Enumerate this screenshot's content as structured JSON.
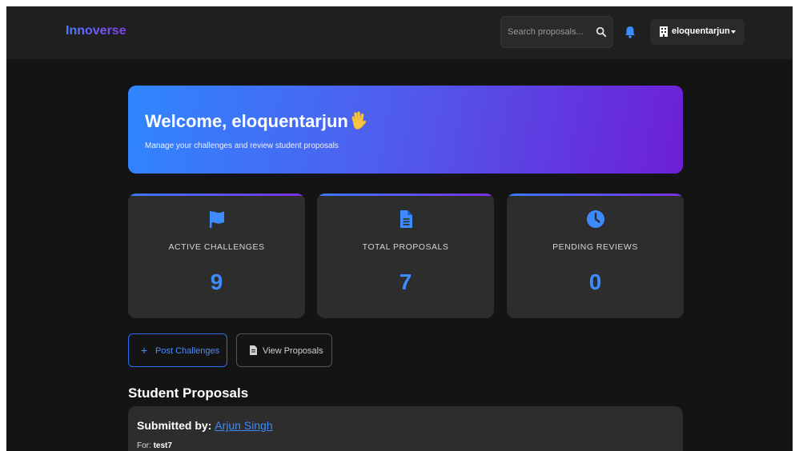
{
  "navbar": {
    "brand": "Innoverse",
    "search": {
      "placeholder": "Search proposals..."
    },
    "user": {
      "name": "eloquentarjun"
    }
  },
  "welcome": {
    "title": "Welcome, eloquentarjun",
    "subtitle": "Manage your challenges and review student proposals"
  },
  "stats": [
    {
      "label": "ACTIVE CHALLENGES",
      "value": "9",
      "icon": "flag-icon"
    },
    {
      "label": "TOTAL PROPOSALS",
      "value": "7",
      "icon": "file-icon"
    },
    {
      "label": "PENDING REVIEWS",
      "value": "0",
      "icon": "clock-icon"
    }
  ],
  "actions": {
    "post_label": "Post Challenges",
    "view_label": "View Proposals"
  },
  "proposals": {
    "section_title": "Student Proposals",
    "items": [
      {
        "submitted_prefix": "Submitted by:",
        "student": "Arjun Singh",
        "for_prefix": "For:",
        "challenge": "test7"
      }
    ]
  },
  "colors": {
    "accent": "#3d8bff",
    "gradient_start": "#2f86ff",
    "gradient_end": "#6d1fd6",
    "background": "#141414",
    "card": "#2d2d2d"
  }
}
